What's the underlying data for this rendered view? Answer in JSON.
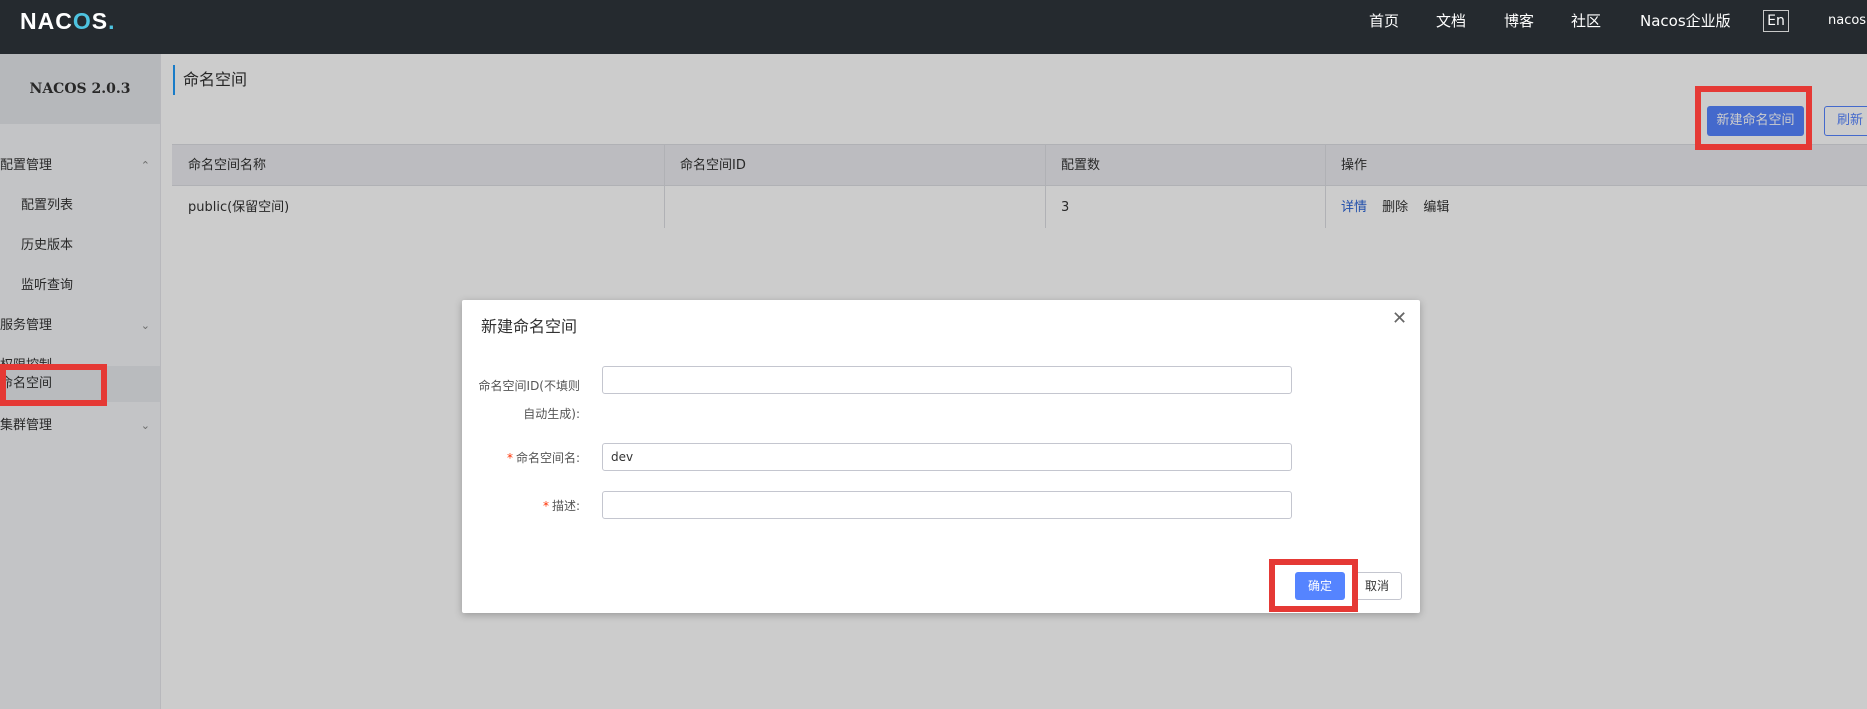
{
  "topbar": {
    "logo": "NACOS.",
    "nav": [
      "首页",
      "文档",
      "博客",
      "社区",
      "Nacos企业版"
    ],
    "lang": "En",
    "user": "nacos"
  },
  "sidebar": {
    "version": "NACOS 2.0.3",
    "items": [
      {
        "label": "配置管理",
        "chevron": "^"
      },
      {
        "label": "配置列表"
      },
      {
        "label": "历史版本"
      },
      {
        "label": "监听查询"
      },
      {
        "label": "服务管理",
        "chevron": "v"
      },
      {
        "label": "权限控制",
        "chevron": "v"
      },
      {
        "label": "命名空间"
      },
      {
        "label": "集群管理",
        "chevron": "v"
      }
    ]
  },
  "main": {
    "title": "命名空间",
    "create_button": "新建命名空间",
    "refresh_button": "刷新",
    "table": {
      "headers": [
        "命名空间名称",
        "命名空间ID",
        "配置数",
        "操作"
      ],
      "rows": [
        {
          "name": "public(保留空间)",
          "id": "",
          "count": "3",
          "actions": [
            "详情",
            "删除",
            "编辑"
          ]
        }
      ]
    }
  },
  "dialog": {
    "title": "新建命名空间",
    "fields": {
      "id_label_line1": "命名空间ID(不填则",
      "id_label_line2": "自动生成):",
      "id_value": "",
      "name_label": "命名空间名:",
      "name_value": "dev",
      "desc_label": "描述:",
      "desc_value": ""
    },
    "required_mark": "*",
    "ok_button": "确定",
    "cancel_button": "取消"
  },
  "colors": {
    "topbar": "#252a2f",
    "primary": "#5584ff",
    "highlight": "#e53935"
  }
}
